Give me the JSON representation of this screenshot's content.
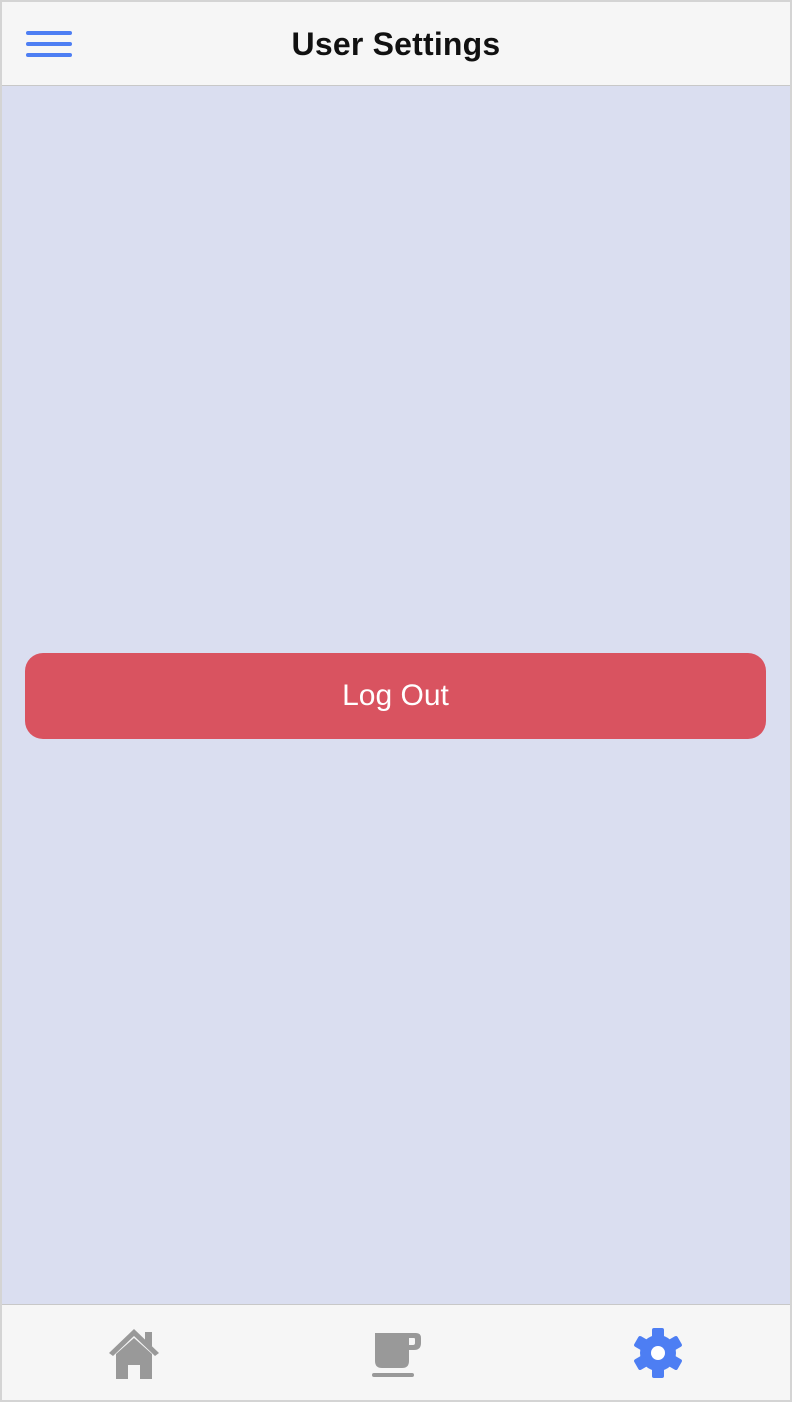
{
  "header": {
    "title": "User Settings",
    "menu_icon": "hamburger-menu-icon"
  },
  "main": {
    "logout_label": "Log Out"
  },
  "tabbar": {
    "tabs": [
      {
        "icon": "home-icon",
        "active": false
      },
      {
        "icon": "coffee-cup-icon",
        "active": false
      },
      {
        "icon": "gear-icon",
        "active": true
      }
    ]
  },
  "colors": {
    "accent": "#4d7ef3",
    "danger": "#d95360",
    "content_background": "#dadef0",
    "bar_background": "#f6f6f6",
    "inactive_icon": "#999999"
  }
}
